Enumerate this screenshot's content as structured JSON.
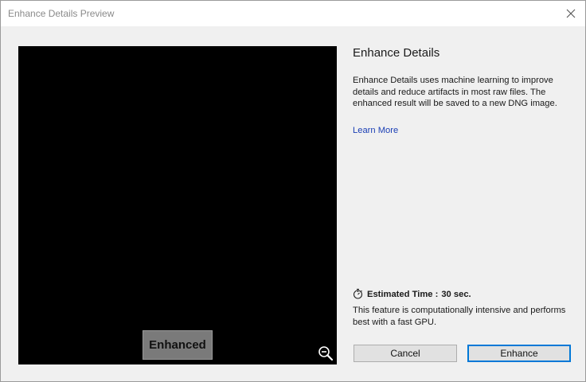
{
  "window": {
    "title": "Enhance Details Preview",
    "close_icon": "close-icon"
  },
  "preview": {
    "badge_label": "Enhanced",
    "zoom_icon": "zoom-out-icon"
  },
  "panel": {
    "title": "Enhance Details",
    "description": "Enhance Details uses machine learning to improve details and reduce artifacts in most raw files. The enhanced result will be saved to a new DNG image.",
    "learn_more": "Learn More",
    "estimated_label": "Estimated Time :",
    "estimated_value": "30 sec.",
    "stopwatch_icon": "stopwatch-icon",
    "note": "This feature is computationally intensive and performs best with a fast GPU."
  },
  "buttons": {
    "cancel": "Cancel",
    "enhance": "Enhance"
  },
  "colors": {
    "accent": "#0078d7",
    "link": "#1b3fb5",
    "preview_bg": "#000000"
  }
}
